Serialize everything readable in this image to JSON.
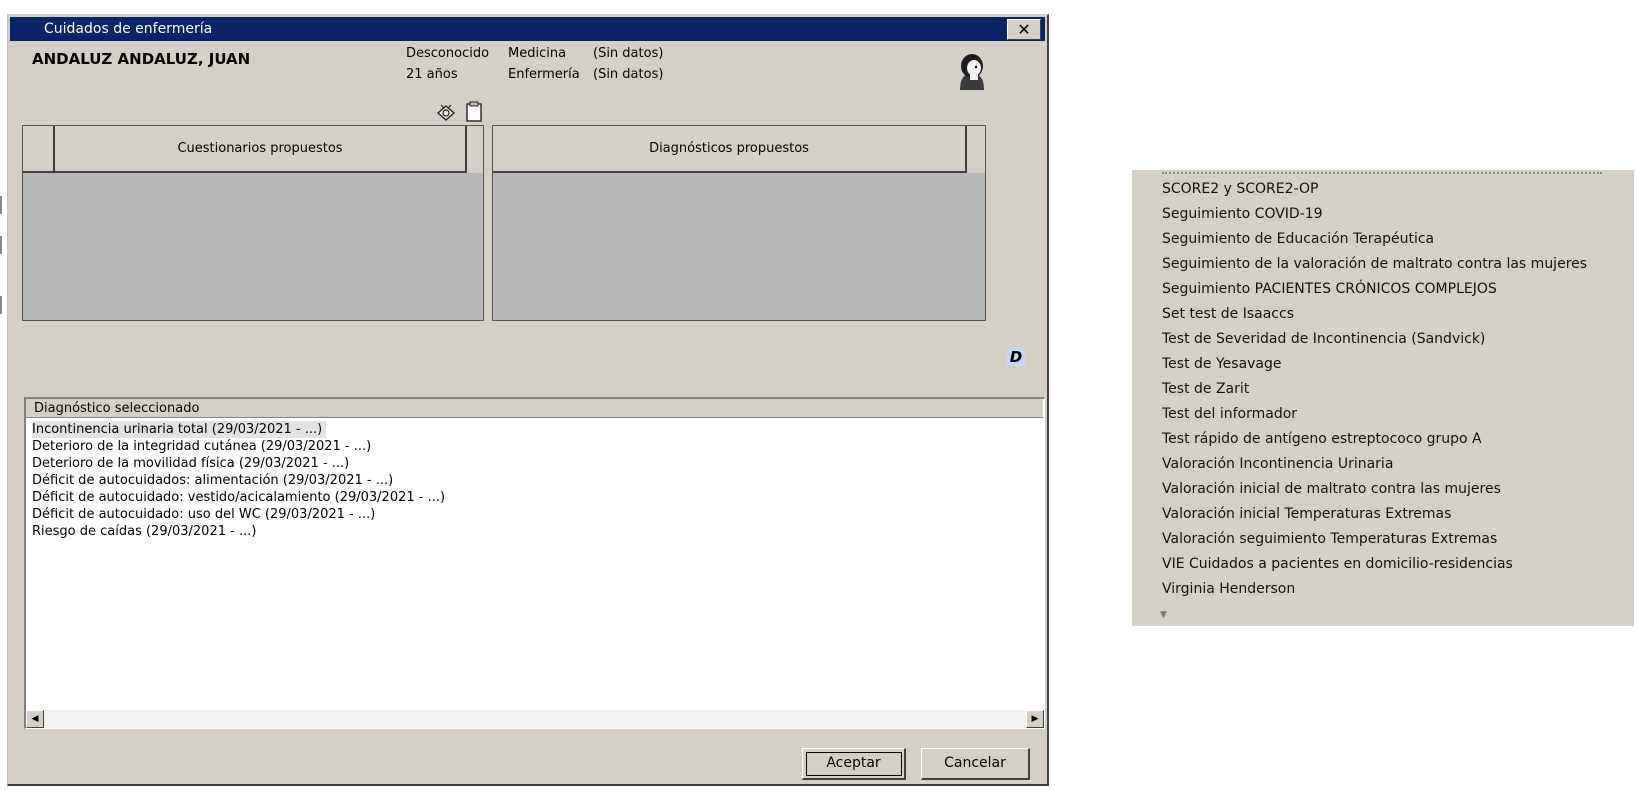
{
  "window": {
    "title": "Cuidados de enfermería",
    "close_label": "✕"
  },
  "patient": {
    "name": "ANDALUZ ANDALUZ, JUAN",
    "sex": "Desconocido",
    "age": "21 años",
    "medicina_label": "Medicina",
    "enfermeria_label": "Enfermería",
    "medicina_value": "(Sin datos)",
    "enfermeria_value": "(Sin datos)"
  },
  "panels": {
    "questionnaires_header": "Cuestionarios propuestos",
    "diagnoses_header": "Diagnósticos propuestos"
  },
  "d_button": "D",
  "selected_list": {
    "header": "Diagnóstico seleccionado",
    "items": [
      "Incontinencia urinaria total (29/03/2021 - ...)",
      "Deterioro de la integridad cutánea (29/03/2021 - ...)",
      "Deterioro de la movilidad física (29/03/2021 - ...)",
      "Déficit de autocuidados: alimentación (29/03/2021 - ...)",
      "Déficit de autocuidado: vestido/acicalamiento (29/03/2021 - ...)",
      "Déficit de autocuidado: uso del WC (29/03/2021 - ...)",
      "Riesgo de caídas (29/03/2021 - ...)"
    ]
  },
  "buttons": {
    "accept": "Aceptar",
    "cancel": "Cancelar"
  },
  "dropdown_list": {
    "items": [
      "SCORE2 y SCORE2-OP",
      "Seguimiento COVID-19",
      "Seguimiento de Educación Terapéutica",
      "Seguimiento de la valoración de maltrato contra las mujeres",
      "Seguimiento PACIENTES CRÓNICOS COMPLEJOS",
      "Set test de Isaaccs",
      "Test de Severidad de Incontinencia (Sandvick)",
      "Test de Yesavage",
      "Test de Zarit",
      "Test del informador",
      "Test rápido de antígeno estreptococo grupo A",
      "Valoración Incontinencia Urinaria",
      "Valoración inicial de maltrato contra las mujeres",
      "Valoración inicial Temperaturas Extremas",
      "Valoración seguimiento  Temperaturas Extremas",
      "VIE Cuidados a pacientes en domicilio-residencias",
      "Virginia Henderson"
    ]
  }
}
